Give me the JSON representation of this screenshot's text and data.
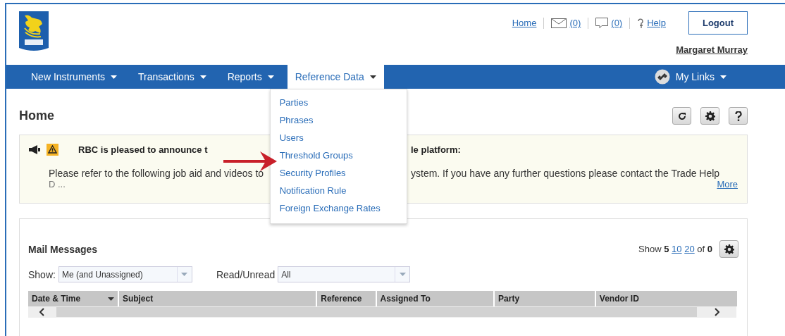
{
  "header": {
    "links": [
      {
        "kind": "link",
        "label": "Home"
      },
      {
        "kind": "mail",
        "label": "(0)"
      },
      {
        "kind": "chat",
        "label": "(0)"
      },
      {
        "kind": "help",
        "label": "Help"
      }
    ],
    "logout": "Logout",
    "user": "Margaret Murray"
  },
  "nav": {
    "items": [
      {
        "label": "New Instruments",
        "selected": false
      },
      {
        "label": "Transactions",
        "selected": false
      },
      {
        "label": "Reports",
        "selected": false
      },
      {
        "label": "Reference Data",
        "selected": true
      }
    ],
    "my_links": "My Links"
  },
  "dropdown": {
    "items": [
      "Parties",
      "Phrases",
      "Users",
      "Threshold Groups",
      "Security Profiles",
      "Notification Rule",
      "Foreign Exchange Rates"
    ]
  },
  "page": {
    "title": "Home"
  },
  "announcement": {
    "headline_start": "RBC is pleased to announce t",
    "headline_end": "le platform:",
    "body_start": "Please refer to the following job aid and videos to",
    "body_end": "ystem. If you have any further questions please contact the Trade Help",
    "body_wrap": "D ...",
    "more": "More"
  },
  "mail": {
    "title": "Mail Messages",
    "pager": {
      "prefix": "Show",
      "options": [
        {
          "label": "5",
          "selected": true
        },
        {
          "label": "10",
          "selected": false
        },
        {
          "label": "20",
          "selected": false
        }
      ],
      "of": "of",
      "total": "0"
    },
    "filters": [
      {
        "label": "Show:",
        "value": "Me (and Unassigned)"
      },
      {
        "label": "Read/Unread",
        "value": "All"
      }
    ],
    "columns": [
      {
        "label": "Date & Time",
        "sorted": true
      },
      {
        "label": "Subject",
        "sorted": false
      },
      {
        "label": "Reference",
        "sorted": false
      },
      {
        "label": "Assigned To",
        "sorted": false
      },
      {
        "label": "Party",
        "sorted": false
      },
      {
        "label": "Vendor ID",
        "sorted": false
      }
    ]
  }
}
